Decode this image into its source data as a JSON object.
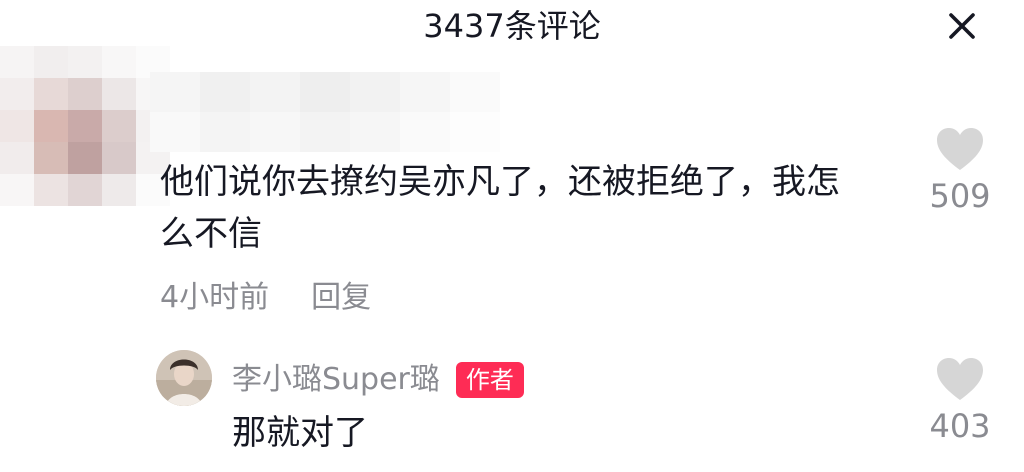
{
  "header": {
    "title": "3437条评论",
    "close_icon": "close-icon"
  },
  "comment": {
    "text": "他们说你去撩约吴亦凡了，还被拒绝了，我怎么不信",
    "time": "4小时前",
    "reply_label": "回复",
    "like_count": "509",
    "like_icon": "heart-icon"
  },
  "reply": {
    "username": "李小璐Super璐",
    "badge": "作者",
    "text": "那就对了",
    "like_count": "403",
    "like_icon": "heart-icon"
  },
  "colors": {
    "text": "#161823",
    "secondary_text": "#8a8b91",
    "badge": "#fe2c55",
    "heart": "#d6d6d6"
  }
}
